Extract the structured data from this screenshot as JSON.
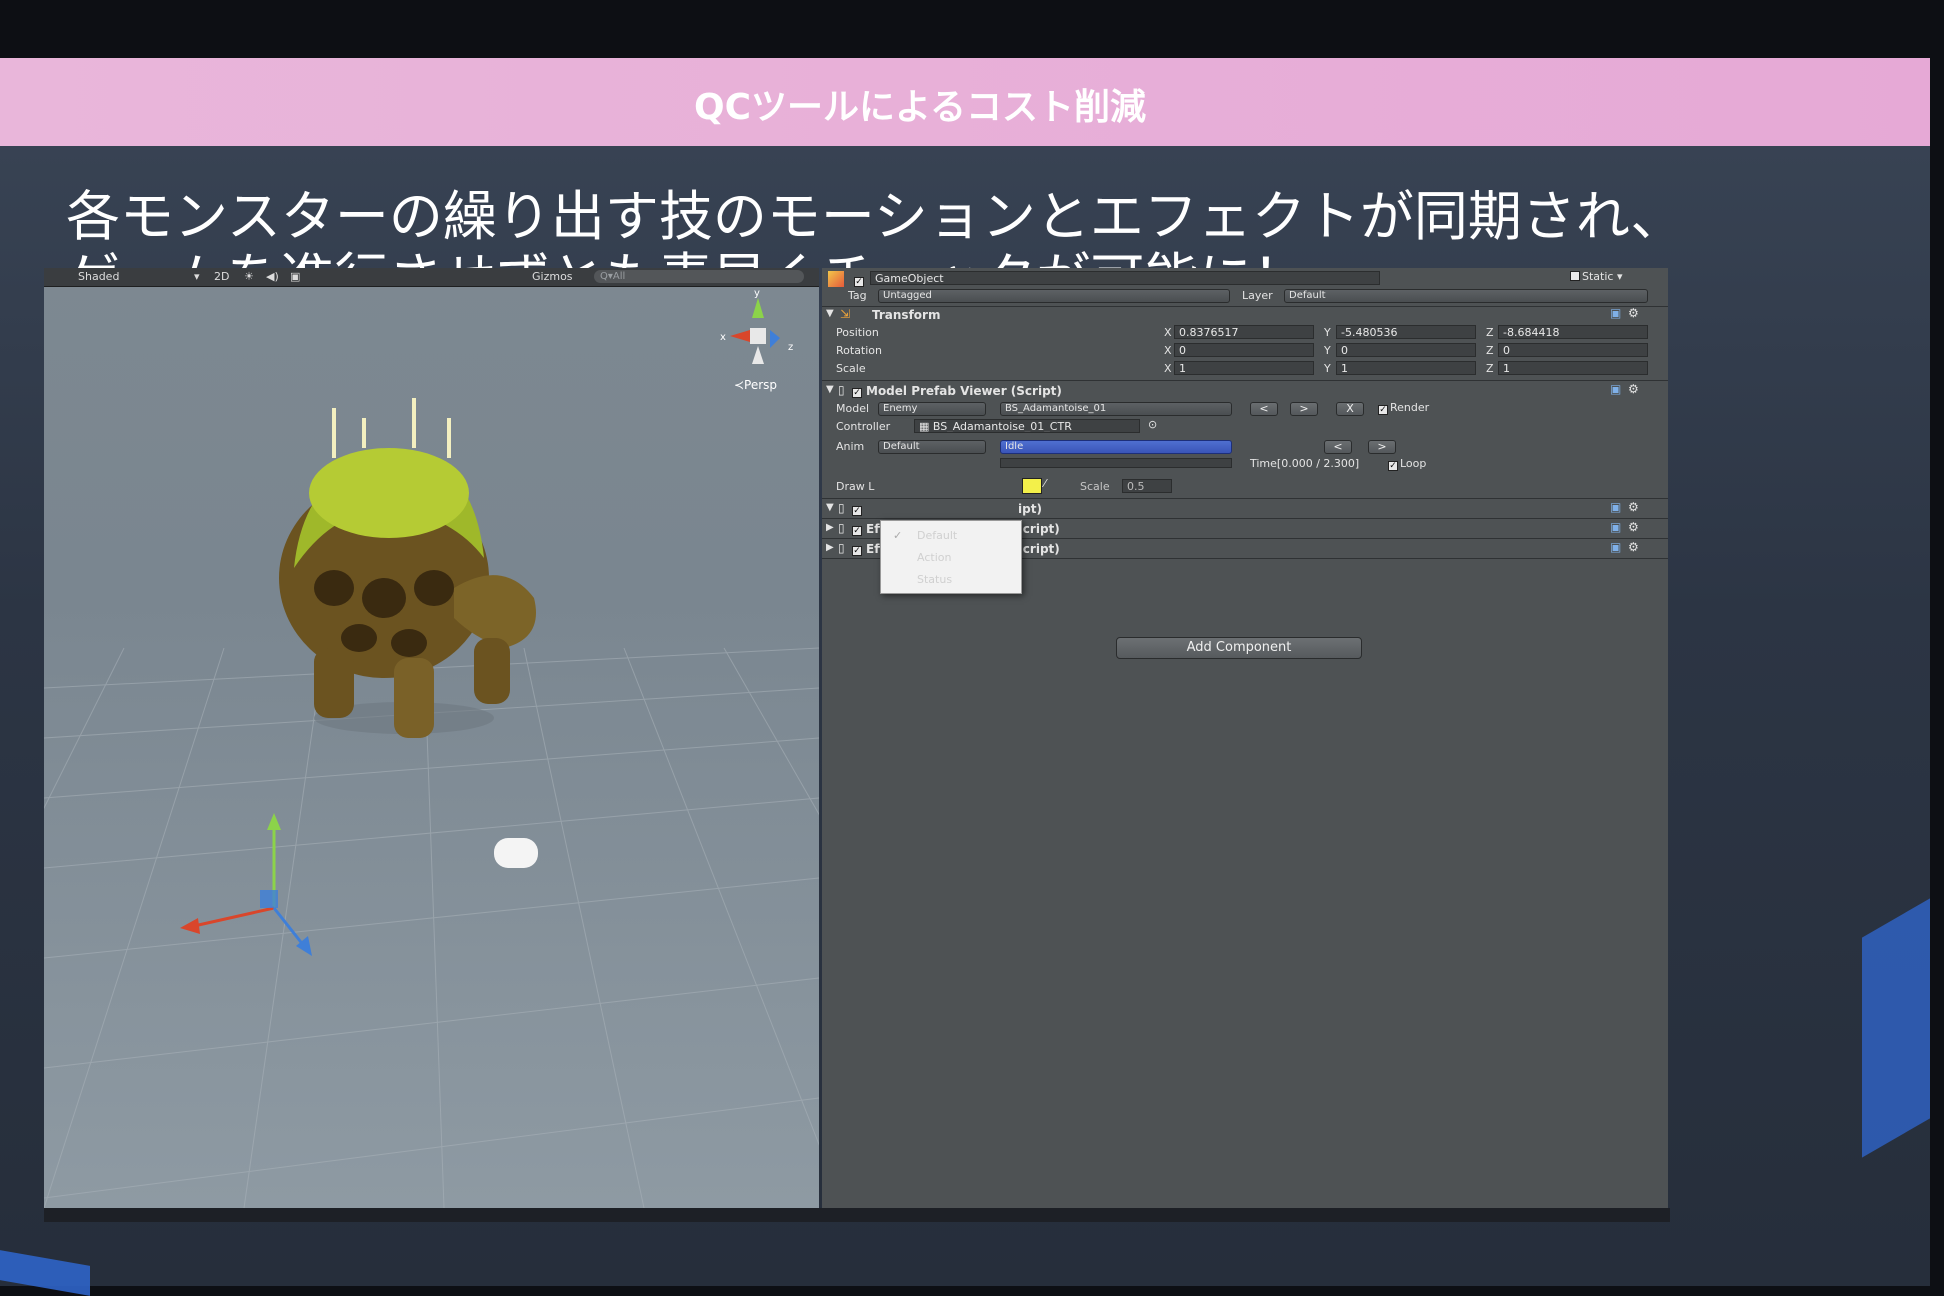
{
  "slide": {
    "header_title": "QCツールによるコスト削減",
    "headline_line1": "各モンスターの繰り出す技のモーションとエフェクトが同期され、",
    "headline_line2": "ゲームを進行させずとも素早くチェックが可能に！",
    "colors": {
      "header_bg": "#e8b0d8",
      "slide_bg": "#2c3544",
      "accent": "#2f64c8"
    }
  },
  "scene_view": {
    "shading_mode": "Shaded",
    "mode_2d": "2D",
    "gizmos": "Gizmos",
    "search_placeholder": "Q▾All",
    "projection": "≺Persp",
    "axis_y": "y",
    "axis_x": "x",
    "axis_z": "z"
  },
  "inspector": {
    "object_name": "GameObject",
    "static_label": "Static",
    "tag_label": "Tag",
    "tag_value": "Untagged",
    "layer_label": "Layer",
    "layer_value": "Default",
    "transform": {
      "title": "Transform",
      "position_label": "Position",
      "rotation_label": "Rotation",
      "scale_label": "Scale",
      "position": {
        "x": "0.8376517",
        "y": "-5.480536",
        "z": "-8.684418"
      },
      "rotation": {
        "x": "0",
        "y": "0",
        "z": "0"
      },
      "scale": {
        "x": "1",
        "y": "1",
        "z": "1"
      }
    },
    "model_viewer": {
      "title": "Model Prefab Viewer (Script)",
      "model_label": "Model",
      "model_type": "Enemy",
      "model_name": "BS_Adamantoise_01",
      "prev": "<",
      "next": ">",
      "close": "X",
      "render_label": "Render",
      "controller_label": "Controller",
      "controller_value": "BS_Adamantoise_01_CTR",
      "anim_label": "Anim",
      "anim_category": "Default",
      "anim_clip": "Idle",
      "time_label": "Time[0.000 / 2.300]",
      "loop_label": "Loop",
      "draw_label": "Draw L",
      "scale_label": "Scale",
      "scale_value": "0.5",
      "dropdown_options": [
        "Default",
        "Action",
        "Status"
      ]
    },
    "collapsed_components": [
      {
        "title": "ipt)"
      },
      {
        "title": "Effect Prefab Viewer (Script)"
      },
      {
        "title": "Effect Prefab Viewer (Script)"
      }
    ],
    "add_component": "Add Component"
  }
}
